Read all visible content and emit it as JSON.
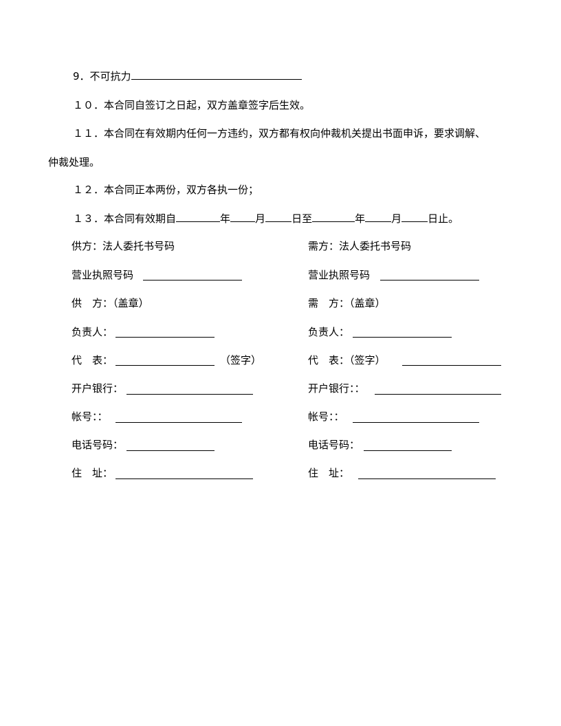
{
  "clauses": {
    "c9": {
      "num": "9．",
      "text": "不可抗力"
    },
    "c10": {
      "num": "１０．",
      "text": "本合同自签订之日起，双方盖章签字后生效。"
    },
    "c11": {
      "num": "１１．",
      "text": "本合同在有效期内任何一方违约，双方都有权向仲裁机关提出书面申诉，要求调解、",
      "cont": "仲裁处理。"
    },
    "c12": {
      "num": "１２．",
      "text": "本合同正本两份，双方各执一份；"
    },
    "c13": {
      "num": "１３．",
      "text": "本合同有效期自",
      "year1": "年",
      "month1": "月",
      "day1": "日至",
      "year2": "年",
      "month2": "月",
      "day2": "日止。"
    }
  },
  "supplier": {
    "power_of_attorney": "供方：法人委托书号码",
    "license": "营业执照号码",
    "party": "供　方：（盖章）",
    "responsible": "负责人：",
    "representative": "代　表：",
    "sign": "（签字）",
    "bank": "开户银行：",
    "account": "帐号：：",
    "phone": "电话号码：",
    "address": "住　址："
  },
  "buyer": {
    "power_of_attorney": "需方：法人委托书号码",
    "license": "营业执照号码",
    "party": "需　方：（盖章）",
    "responsible": "负责人：",
    "representative": "代　表：（签字）",
    "bank": "开户银行：：",
    "account": "帐号：：",
    "phone": "电话号码：",
    "address": "住　址："
  }
}
